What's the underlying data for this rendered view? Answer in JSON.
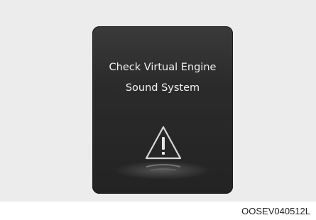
{
  "display": {
    "message_line_1": "Check Virtual Engine",
    "message_line_2": "Sound System",
    "icon": "warning-triangle-icon"
  },
  "figure_code": "OOSEV040512L"
}
